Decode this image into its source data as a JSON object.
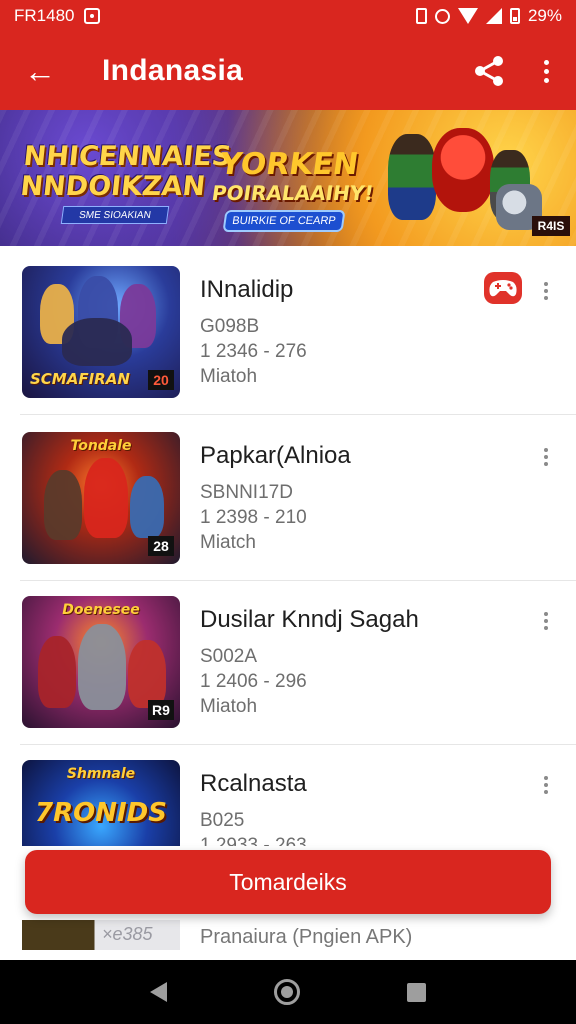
{
  "status_bar": {
    "time": "FR1480",
    "battery": "29%"
  },
  "app_bar": {
    "title": "Indanasia",
    "back_icon": "arrow-left-icon",
    "share_icon": "share-icon",
    "more_icon": "more-vert-icon"
  },
  "banner": {
    "left_title": "NHICENNAIES NNDOIKZAN",
    "left_subtitle": "SME SIOAKIAN",
    "center_title": "YORKEN",
    "center_title2": "POIRALAAIHY!",
    "cta": "BUIRKIE OF CEARP",
    "badge": "R4IS"
  },
  "games": [
    {
      "title": "INnalidip",
      "code": "G098B",
      "stats": "1 2346 - 276",
      "label": "Miatoh",
      "thumb_caption": "SCMAFIRAN",
      "thumb_badge": "20"
    },
    {
      "title": "Papkar(Alnioa",
      "code": "SBNNI17D",
      "stats": "1 2398 - 210",
      "label": "Miatch",
      "thumb_caption": "Tondale",
      "thumb_badge": "28"
    },
    {
      "title": "Dusilar Knndj Sagah",
      "code": "S002A",
      "stats": "1 2406 - 296",
      "label": "Miatoh",
      "thumb_caption": "Doenesee",
      "thumb_badge": "R9"
    },
    {
      "title": "Rcalnasta",
      "code": "B025",
      "stats": "1 2933 - 263",
      "label": "",
      "thumb_caption": "Shmnale",
      "thumb_big": "7RONIDS",
      "thumb_badge": ""
    }
  ],
  "partial_item": {
    "title": "Pranaiura (Pngien APK)",
    "thumb_text": "×e385"
  },
  "primary_button": {
    "label": "Tomardeiks"
  },
  "colors": {
    "accent": "#d9261f"
  }
}
